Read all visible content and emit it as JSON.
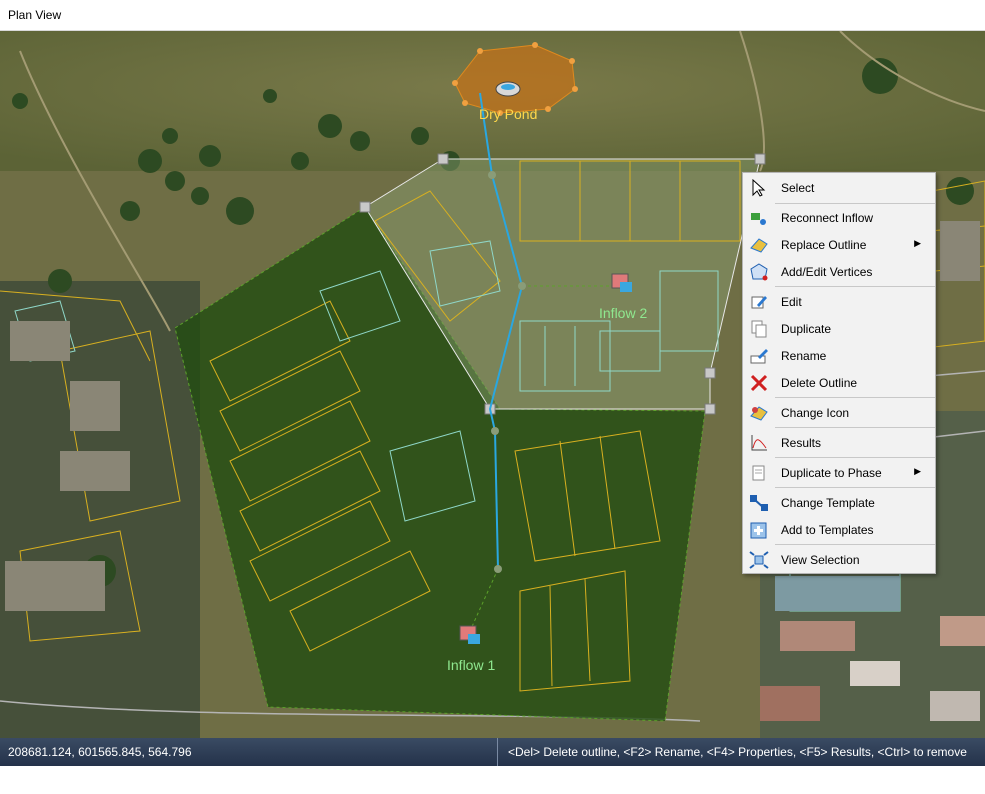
{
  "window": {
    "title": "Plan View"
  },
  "map": {
    "labels": {
      "dry_pond": "Dry Pond",
      "inflow_1": "Inflow 1",
      "inflow_2": "Inflow 2"
    },
    "colors": {
      "outline_green": "#3f7f1e",
      "selection_white": "#e8e8e8",
      "flow_line": "#2aa7e0",
      "parcel_yellow": "#d8b020",
      "parcel_cyan": "#8fd7c8",
      "pond_orange": "#e08a1e",
      "label_green": "#8fe88f",
      "label_yellow": "#ffd84a"
    }
  },
  "context_menu": {
    "items": [
      {
        "label": "Select",
        "icon": "cursor-arrow-icon"
      },
      {
        "label": "Reconnect Inflow",
        "icon": "reconnect-inflow-icon"
      },
      {
        "label": "Replace Outline",
        "icon": "replace-outline-icon",
        "submenu": "▶"
      },
      {
        "label": "Add/Edit Vertices",
        "icon": "vertices-icon"
      },
      {
        "label": "Edit",
        "icon": "edit-pencil-icon"
      },
      {
        "label": "Duplicate",
        "icon": "duplicate-icon"
      },
      {
        "label": "Rename",
        "icon": "rename-icon"
      },
      {
        "label": "Delete Outline",
        "icon": "delete-x-icon"
      },
      {
        "label": "Change Icon",
        "icon": "change-icon-icon"
      },
      {
        "label": "Results",
        "icon": "results-chart-icon"
      },
      {
        "label": "Duplicate to Phase",
        "icon": "duplicate-phase-icon",
        "submenu": "▶"
      },
      {
        "label": "Change Template",
        "icon": "change-template-icon"
      },
      {
        "label": "Add to Templates",
        "icon": "add-template-icon"
      },
      {
        "label": "View Selection",
        "icon": "view-selection-icon"
      }
    ]
  },
  "status": {
    "coordinates": "208681.124, 601565.845, 564.796",
    "hint": "<Del> Delete outline, <F2> Rename, <F4> Properties, <F5> Results, <Ctrl> to remove from selection"
  }
}
